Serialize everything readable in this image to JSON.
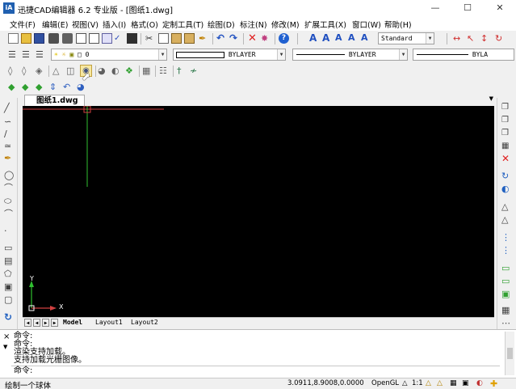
{
  "window": {
    "logo": "iA",
    "title": "迅捷CAD编辑器 6.2 专业版  - [图纸1.dwg]",
    "min_icon": "minimize-icon",
    "max_icon": "maximize-icon",
    "close_icon": "close-icon"
  },
  "menu": [
    "文件(F)",
    "编辑(E)",
    "视图(V)",
    "插入(I)",
    "格式(O)",
    "定制工具(T)",
    "绘图(D)",
    "标注(N)",
    "修改(M)",
    "扩展工具(X)",
    "窗口(W)",
    "帮助(H)"
  ],
  "toolbar": {
    "text_style": "Standard",
    "layer_name": "0",
    "color_value": "BYLAYER",
    "linetype_value": "BYLAYER",
    "lineweight_value": "BYLA"
  },
  "document": {
    "tab_label": "图纸1.dwg",
    "tab_close": "×"
  },
  "canvas": {
    "background": "#000000",
    "axis_y": "Y",
    "axis_x": "X",
    "crosshair_color": "#d04040",
    "axis_color": "#30c030"
  },
  "layout_tabs": [
    "Model",
    "Layout1",
    "Layout2"
  ],
  "command": {
    "lines": [
      "命令:",
      "命令:",
      "渲染支持加载。",
      "支持加载光栅图像。",
      "命令:"
    ],
    "close_mark": "×"
  },
  "status": {
    "message": "绘制一个球体",
    "coords": "3.0911,8.9008,0.0000",
    "renderer": "OpenGL",
    "scale": "1:1"
  }
}
